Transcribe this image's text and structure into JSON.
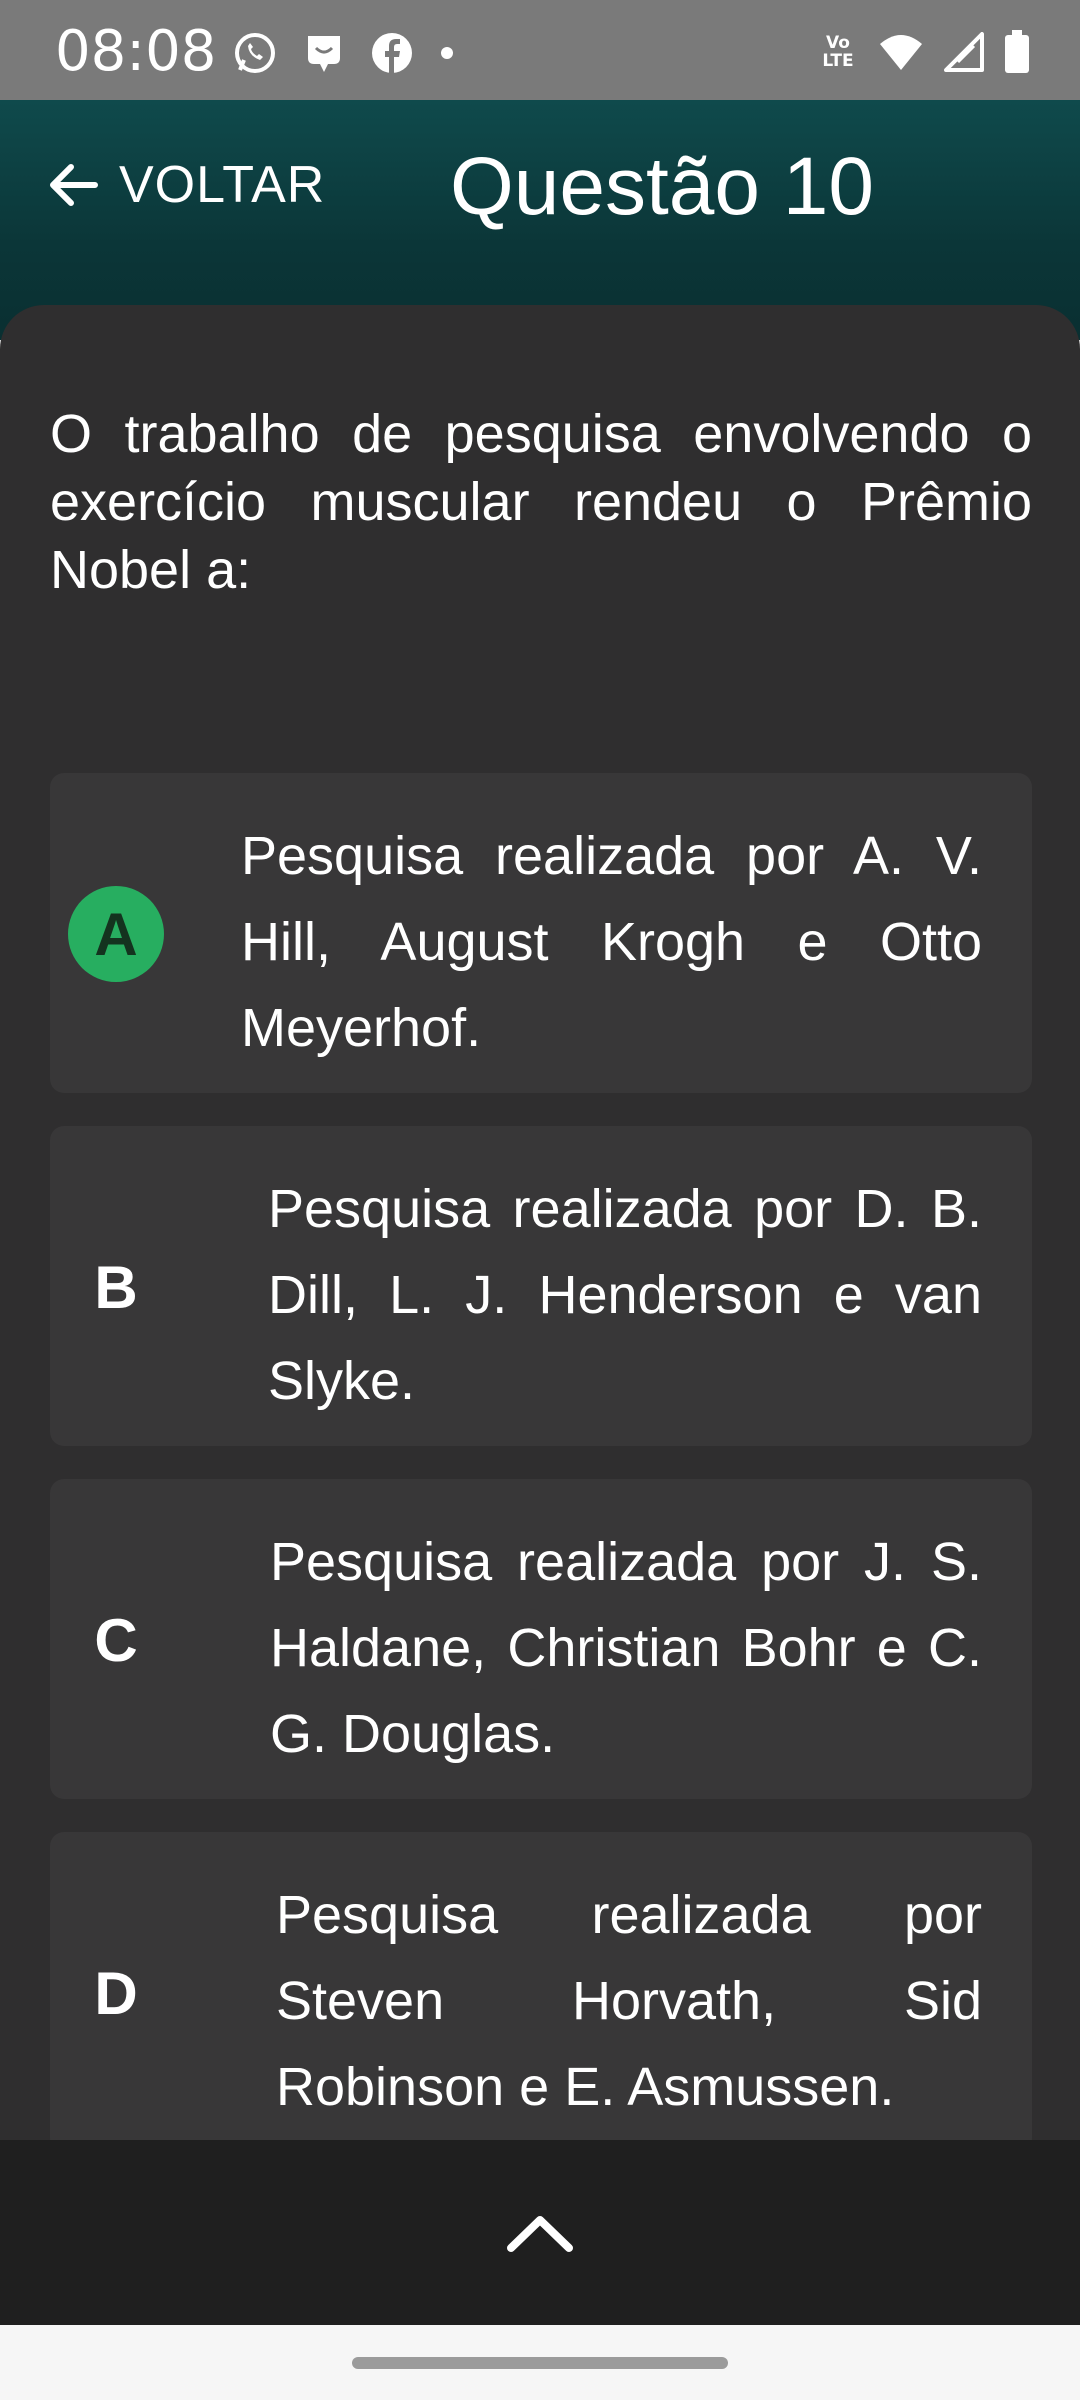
{
  "status_bar": {
    "time": "08:08",
    "notification_icons": [
      "whatsapp-icon",
      "chat-bubble-icon",
      "facebook-icon",
      "dot-icon"
    ],
    "system_icons": [
      "volte-icon",
      "wifi-icon",
      "signal-icon",
      "battery-icon"
    ],
    "volte_text": "Vo LTE"
  },
  "header": {
    "back_label": "VOLTAR",
    "title": "Questão 10"
  },
  "question": {
    "text": "O trabalho de pesquisa envolvendo o exercício muscular rendeu o Prêmio Nobel a:"
  },
  "options": [
    {
      "letter": "A",
      "text": "Pesquisa realizada por A. V. Hill, August Krogh e Otto Meyerhof.",
      "selected": true
    },
    {
      "letter": "B",
      "text": "Pesquisa realizada por D. B. Dill, L. J. Henderson e van Slyke.",
      "selected": false
    },
    {
      "letter": "C",
      "text": "Pesquisa realizada por J. S. Haldane, Christian Bohr e C. G. Douglas.",
      "selected": false
    },
    {
      "letter": "D",
      "text": "Pesquisa realizada por Steven Horvath, Sid Robinson e E. Asmussen.",
      "selected": false
    }
  ],
  "colors": {
    "accent_selected": "#27ae60",
    "header_bg": "#0b3638",
    "content_bg": "#2f2e2f",
    "option_bg": "#383738"
  },
  "bottom_bar": {
    "icon": "chevron-up-icon"
  }
}
